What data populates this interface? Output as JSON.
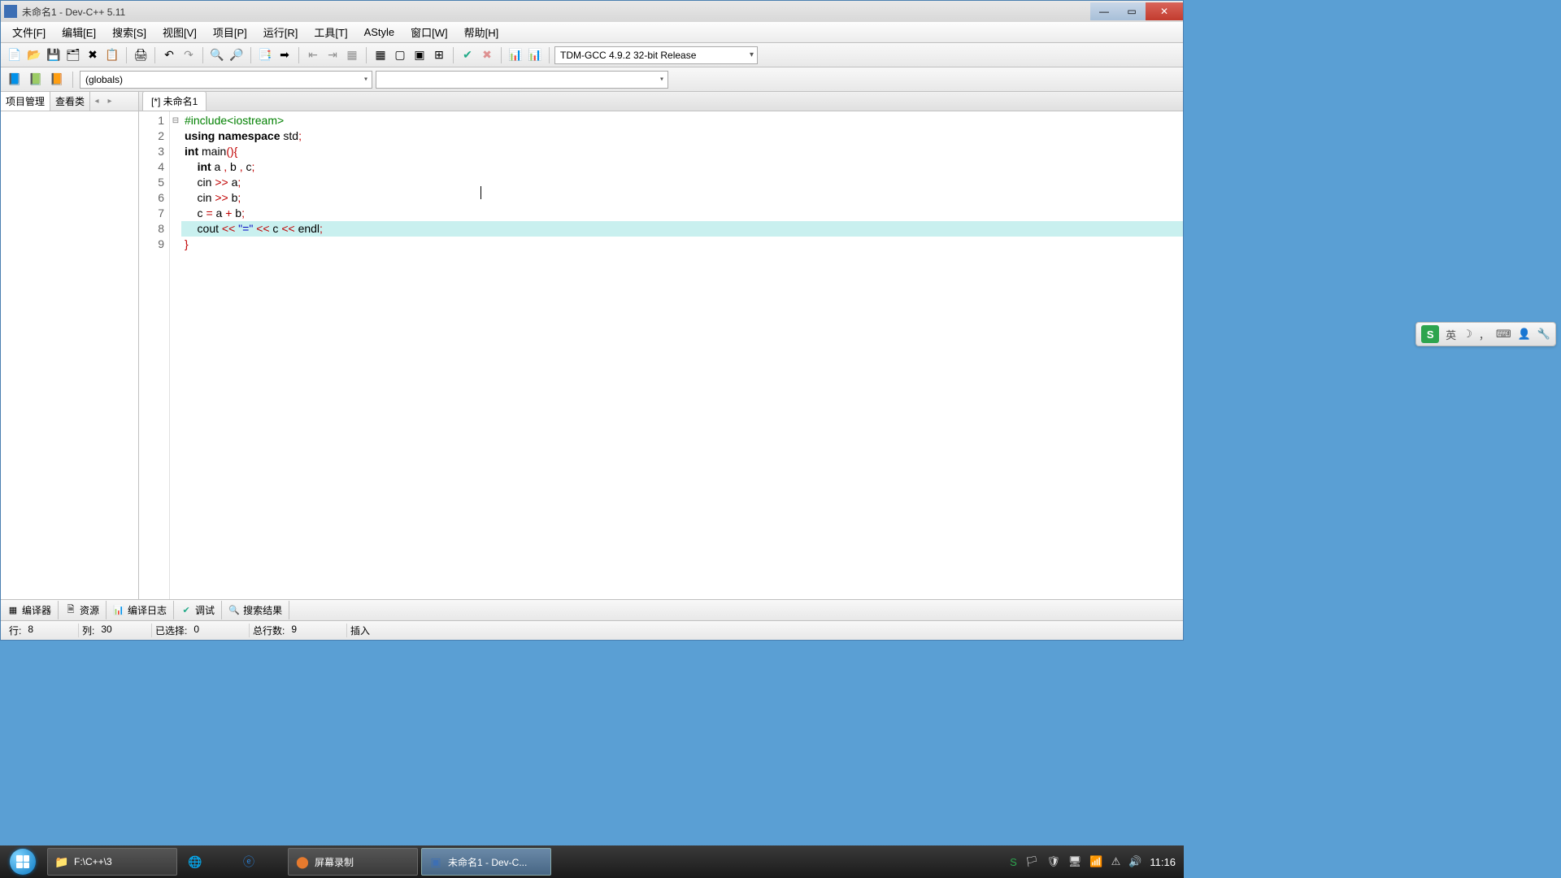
{
  "window": {
    "title": "未命名1 - Dev-C++ 5.11"
  },
  "menu": {
    "file": "文件[F]",
    "edit": "编辑[E]",
    "search": "搜索[S]",
    "view": "视图[V]",
    "project": "项目[P]",
    "run": "运行[R]",
    "tools": "工具[T]",
    "astyle": "AStyle",
    "window": "窗口[W]",
    "help": "帮助[H]"
  },
  "toolbar": {
    "compiler_set": "TDM-GCC 4.9.2 32-bit Release"
  },
  "scope_combo": "(globals)",
  "sidebar": {
    "tab_project": "项目管理",
    "tab_class": "查看类"
  },
  "editor": {
    "tab1": "[*] 未命名1",
    "lines": [
      {
        "n": 1,
        "tokens": [
          [
            "pre",
            "#include<iostream>"
          ]
        ]
      },
      {
        "n": 2,
        "tokens": [
          [
            "kw",
            "using"
          ],
          [
            "id",
            " "
          ],
          [
            "kw",
            "namespace"
          ],
          [
            "id",
            " std"
          ],
          [
            "op",
            ";"
          ]
        ]
      },
      {
        "n": 3,
        "fold": "⊟",
        "tokens": [
          [
            "kw",
            "int"
          ],
          [
            "id",
            " main"
          ],
          [
            "op",
            "(){"
          ]
        ]
      },
      {
        "n": 4,
        "tokens": [
          [
            "id",
            "    "
          ],
          [
            "kw",
            "int"
          ],
          [
            "id",
            " a "
          ],
          [
            "op",
            ","
          ],
          [
            "id",
            " b "
          ],
          [
            "op",
            ","
          ],
          [
            "id",
            " c"
          ],
          [
            "op",
            ";"
          ]
        ]
      },
      {
        "n": 5,
        "tokens": [
          [
            "id",
            "    cin "
          ],
          [
            "op",
            ">>"
          ],
          [
            "id",
            " a"
          ],
          [
            "op",
            ";"
          ]
        ]
      },
      {
        "n": 6,
        "tokens": [
          [
            "id",
            "    cin "
          ],
          [
            "op",
            ">>"
          ],
          [
            "id",
            " b"
          ],
          [
            "op",
            ";"
          ]
        ]
      },
      {
        "n": 7,
        "tokens": [
          [
            "id",
            "    c "
          ],
          [
            "op",
            "="
          ],
          [
            "id",
            " a "
          ],
          [
            "op",
            "+"
          ],
          [
            "id",
            " b"
          ],
          [
            "op",
            ";"
          ]
        ]
      },
      {
        "n": 8,
        "hl": true,
        "tokens": [
          [
            "id",
            "    cout "
          ],
          [
            "op",
            "<<"
          ],
          [
            "id",
            " "
          ],
          [
            "str",
            "\"=\""
          ],
          [
            "id",
            " "
          ],
          [
            "op",
            "<<"
          ],
          [
            "id",
            " c "
          ],
          [
            "op",
            "<<"
          ],
          [
            "id",
            " endl"
          ],
          [
            "op",
            ";"
          ]
        ]
      },
      {
        "n": 9,
        "tokens": [
          [
            "op",
            "}"
          ]
        ]
      }
    ]
  },
  "bottom_tabs": {
    "compiler": "编译器",
    "resource": "资源",
    "log": "编译日志",
    "debug": "调试",
    "search": "搜索结果"
  },
  "status": {
    "line_label": "行:",
    "line_val": "8",
    "col_label": "列:",
    "col_val": "30",
    "sel_label": "已选择:",
    "sel_val": "0",
    "total_label": "总行数:",
    "total_val": "9",
    "mode": "插入"
  },
  "ime": {
    "lang": "英",
    "moon": "☽",
    "comma": "，",
    "kb": "⌨",
    "person": "👤",
    "wrench": "🔧"
  },
  "taskbar": {
    "folder": "F:\\C++\\3",
    "screenrec": "屏幕录制",
    "devcpp": "未命名1 - Dev-C...",
    "clock": "11:16"
  }
}
